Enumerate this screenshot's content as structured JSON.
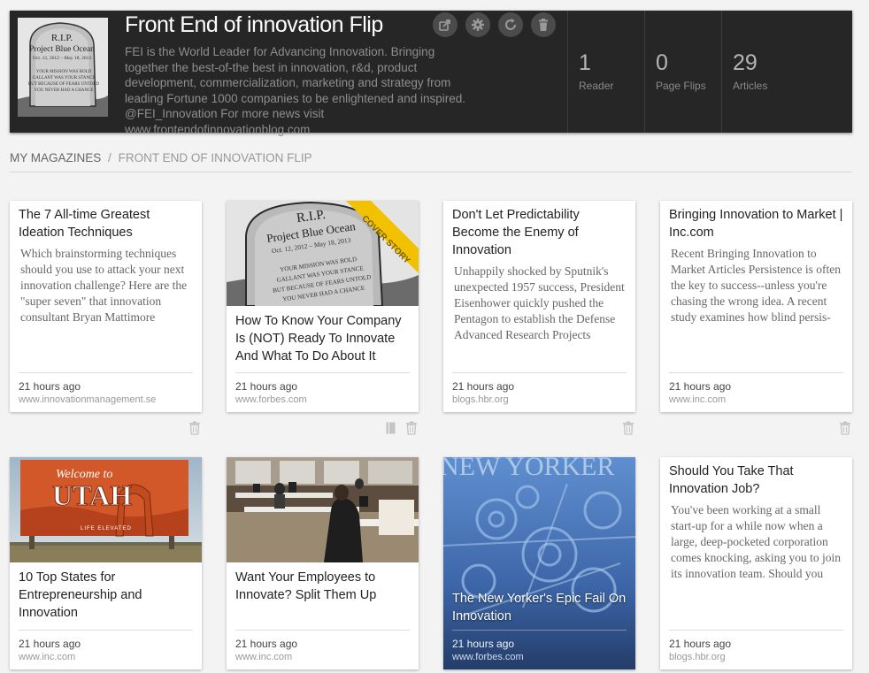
{
  "magazine": {
    "title": "Front End of innovation Flip",
    "description": "FEI is the World Leader for Advancing Innovation. Bringing together the best-of-the best in innovation, r&d, product development, commercialization, marketing and strategy from leading Fortune 1000 companies to be enlightened and inspired. @FEI_Innovation For more news visit www.frontendofinnovationblog.com",
    "cover_text": {
      "rip": "R.I.P.",
      "name": "Project Blue Ocean",
      "dates": "Oct. 12, 2012 – May 18, 2013",
      "epitaph": [
        "YOUR MISSION WAS BOLD",
        "GALLANT WAS YOUR STANCE",
        "BUT BECAUSE OF FEARS UNTOLD",
        "YOU NEVER HAD A CHANCE"
      ]
    },
    "icons": [
      "share-icon",
      "settings-icon",
      "refresh-icon",
      "trash-icon"
    ]
  },
  "stats": [
    {
      "value": "1",
      "label": "Reader"
    },
    {
      "value": "0",
      "label": "Page Flips"
    },
    {
      "value": "29",
      "label": "Articles"
    }
  ],
  "breadcrumb": {
    "root": "MY MAGAZINES",
    "separator": "/",
    "current": "FRONT END OF INNOVATION FLIP"
  },
  "cards": [
    {
      "title": "The 7 All-time Greatest Ideation Techniques",
      "excerpt": "Which brainstorming techniques should you use to attack your next innovation challenge? Here are the \"super seven\" that innovation consultant Bryan Mattimore",
      "time": "21 hours ago",
      "source": "www.innovationmanagement.se"
    },
    {
      "title": "How To Know Your Company Is (NOT) Ready To Innovate And What To Do About It",
      "badge": "COVER STORY",
      "time": "21 hours ago",
      "source": "www.forbes.com"
    },
    {
      "title": "Don't Let Predictability Become the Enemy of Innovation",
      "excerpt": "Unhappily shocked by Sputnik's unexpected 1957 success, President Eisenhower quickly pushed the Pentagon to establish the Defense Advanced Research Projects",
      "time": "21 hours ago",
      "source": "blogs.hbr.org"
    },
    {
      "title": "Bringing Innovation to Market | Inc.com",
      "excerpt": "Recent Bringing Innovation to Market Articles Persistence is often the key to success--unless you're chasing the wrong idea. A recent study examines how blind persis-",
      "time": "21 hours ago",
      "source": "www.inc.com"
    },
    {
      "title": "10 Top States for Entrepreneurship and Innovation",
      "sign": {
        "welcome": "Welcome to",
        "state": "UTAH",
        "tagline": "LIFE ELEVATED"
      },
      "time": "21 hours ago",
      "source": "www.inc.com"
    },
    {
      "title": "Want Your Employees to Innovate? Split Them Up",
      "time": "21 hours ago",
      "source": "www.inc.com"
    },
    {
      "title": "The New Yorker's Epic Fail On Innovation",
      "masthead": "NEW YORKER",
      "time": "21 hours ago",
      "source": "www.forbes.com"
    },
    {
      "title": "Should You Take That Innovation Job?",
      "excerpt": "You've been working at a small start-up for a while now when a large, deep-pocketed corporation comes knocking, asking you to join its innovation team. Should you",
      "time": "21 hours ago",
      "source": "blogs.hbr.org"
    }
  ],
  "colors": {
    "header_bg": "#262626",
    "page_bg": "#f3f3f3",
    "badge": "#f2c200"
  }
}
